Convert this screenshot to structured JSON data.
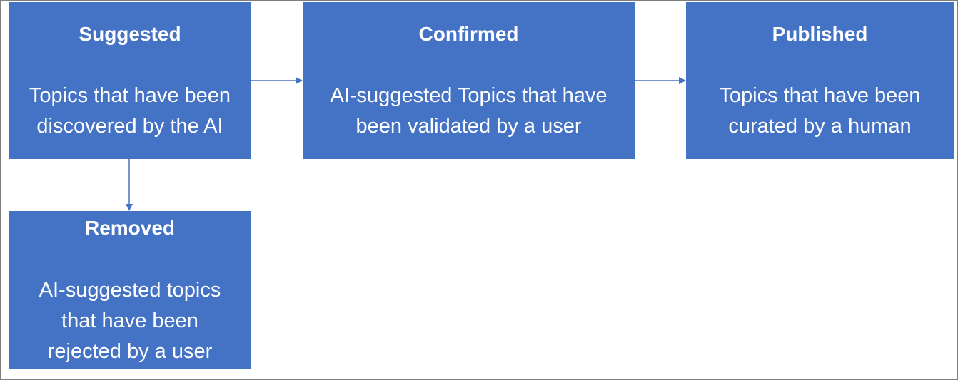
{
  "diagram": {
    "nodes": [
      {
        "id": "suggested",
        "title": "Suggested",
        "description_lines": [
          "Topics that have been",
          "discovered by the AI"
        ]
      },
      {
        "id": "confirmed",
        "title": "Confirmed",
        "description_lines": [
          "AI-suggested Topics that have",
          "been validated by a user"
        ]
      },
      {
        "id": "published",
        "title": "Published",
        "description_lines": [
          "Topics that have been",
          "curated by a human"
        ]
      },
      {
        "id": "removed",
        "title": "Removed",
        "description_lines": [
          "AI-suggested topics",
          "that have been",
          "rejected by a user"
        ]
      }
    ],
    "edges": [
      {
        "from": "suggested",
        "to": "confirmed"
      },
      {
        "from": "confirmed",
        "to": "published"
      },
      {
        "from": "suggested",
        "to": "removed"
      }
    ],
    "colors": {
      "box_fill": "#4472c4",
      "box_text": "#ffffff",
      "connector": "#4472c4",
      "frame": "#7f7f7f"
    }
  }
}
